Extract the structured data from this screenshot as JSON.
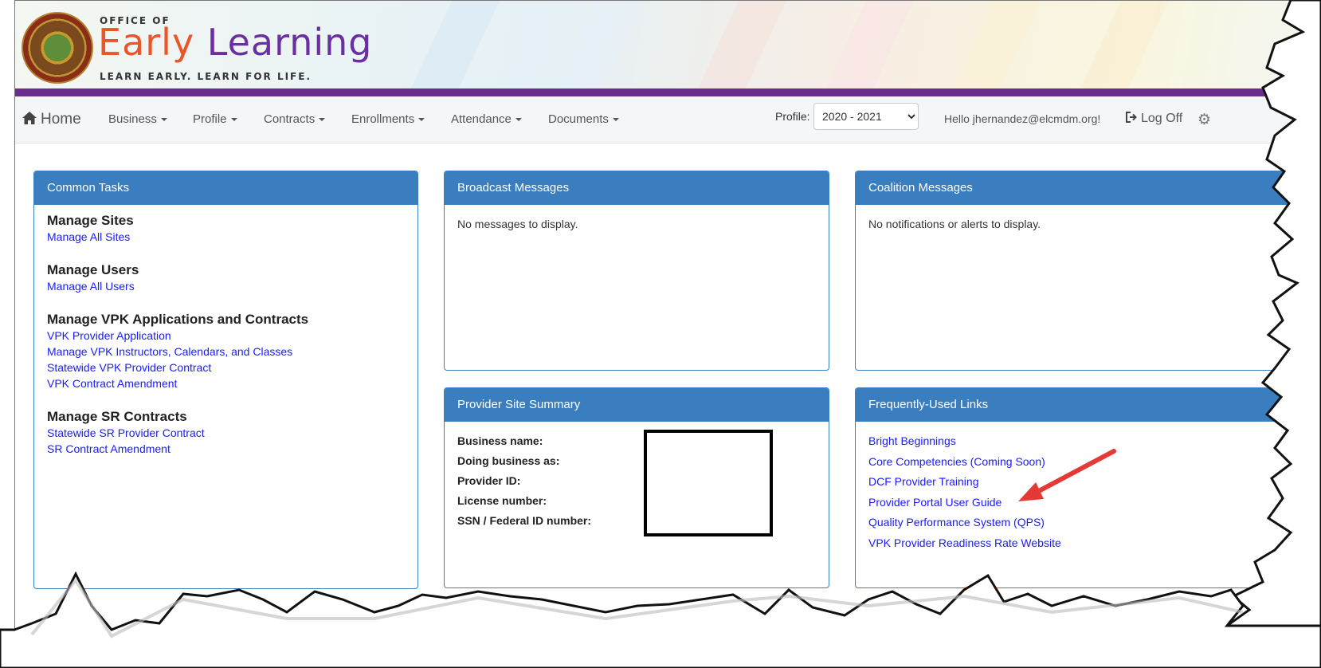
{
  "header": {
    "logo_office": "OFFICE OF",
    "logo_title_part1": "Early",
    "logo_title_part2": "Learning",
    "logo_tagline": "LEARN EARLY. LEARN FOR LIFE.",
    "seal_label": "state-seal"
  },
  "nav": {
    "home": "Home",
    "items": [
      "Business",
      "Profile",
      "Contracts",
      "Enrollments",
      "Attendance",
      "Documents"
    ],
    "profile_label": "Profile:",
    "profile_selected": "2020 - 2021",
    "greeting": "Hello jhernandez@elcmdm.org!",
    "log_off": "Log Off",
    "icons": {
      "home": "home-icon",
      "logoff": "sign-out-icon",
      "settings": "gear-icon"
    }
  },
  "common_tasks": {
    "title": "Common Tasks",
    "sections": [
      {
        "heading": "Manage Sites",
        "links": [
          "Manage All Sites"
        ]
      },
      {
        "heading": "Manage Users",
        "links": [
          "Manage All Users"
        ]
      },
      {
        "heading": "Manage VPK Applications and Contracts",
        "links": [
          "VPK Provider Application",
          "Manage VPK Instructors, Calendars, and Classes",
          "Statewide VPK Provider Contract",
          "VPK Contract Amendment"
        ]
      },
      {
        "heading": "Manage SR Contracts",
        "links": [
          "Statewide SR Provider Contract",
          "SR Contract Amendment"
        ]
      }
    ]
  },
  "broadcast": {
    "title": "Broadcast Messages",
    "body": "No messages to display."
  },
  "coalition": {
    "title": "Coalition Messages",
    "body": "No notifications or alerts to display."
  },
  "provider_summary": {
    "title": "Provider Site Summary",
    "fields": [
      "Business name:",
      "Doing business as:",
      "Provider ID:",
      "License number:",
      "SSN / Federal ID number:"
    ]
  },
  "frequent_links": {
    "title": "Frequently-Used Links",
    "links": [
      "Bright Beginnings",
      "Core Competencies (Coming Soon)",
      "DCF Provider Training",
      "Provider Portal User Guide",
      "Quality Performance System (QPS)",
      "VPK Provider Readiness Rate Website"
    ]
  },
  "colors": {
    "accent": "#3b7ec0",
    "purple": "#6a2e8f",
    "link": "#1a1aff",
    "arrow": "#e53935"
  }
}
